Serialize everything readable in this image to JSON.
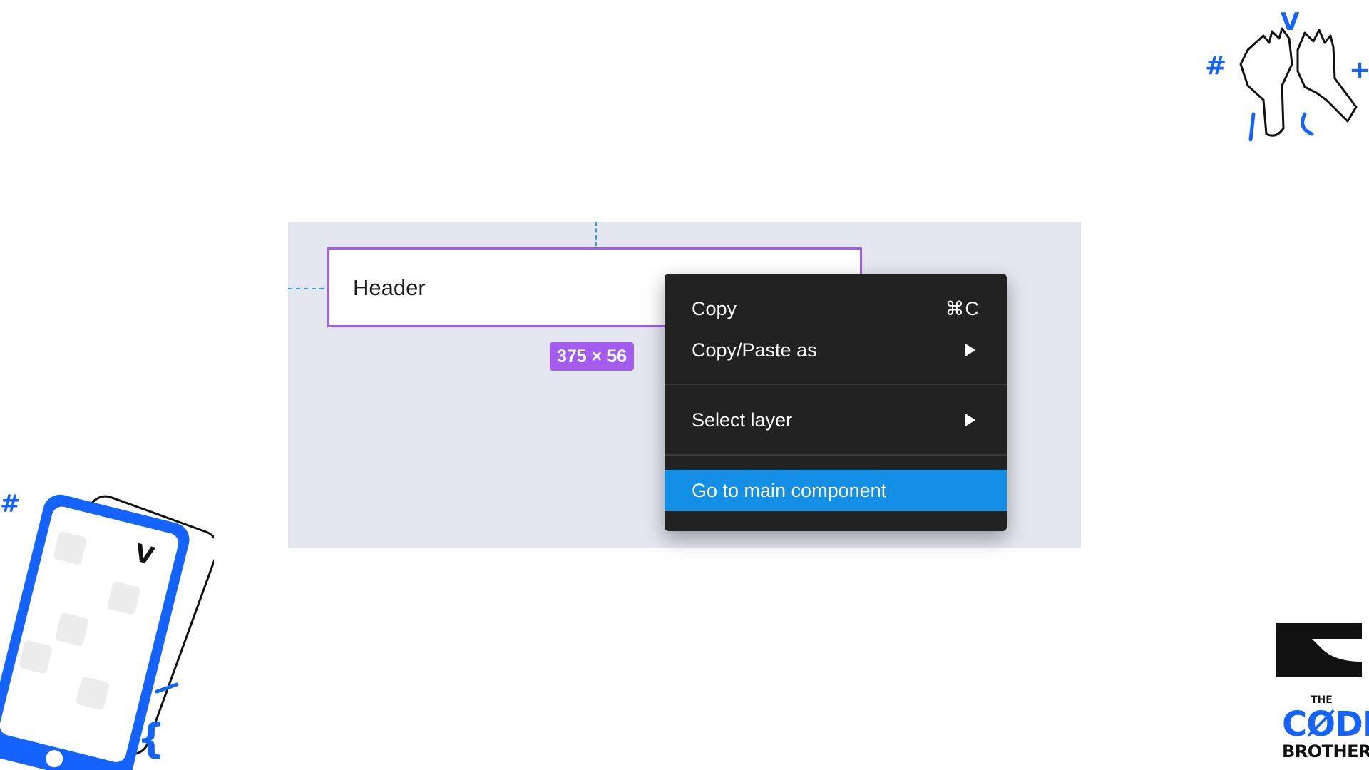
{
  "canvas": {
    "frame_label": "Header",
    "size_badge": "375 × 56"
  },
  "context_menu": {
    "items": [
      {
        "label": "Copy",
        "shortcut": "⌘C"
      },
      {
        "label": "Copy/Paste as",
        "submenu_icon": "chevron-right-icon"
      },
      {
        "label": "Select layer",
        "submenu_icon": "chevron-right-icon"
      },
      {
        "label": "Go to main component",
        "highlighted": true
      }
    ]
  },
  "branding": {
    "small_text": "THE",
    "big_text": "CØDE",
    "sub_text": "BROTHERS"
  },
  "colors": {
    "selection_purple": "#a35bf0",
    "menu_bg": "#222222",
    "menu_highlight": "#1390e6",
    "canvas_bg": "#e4e6f0",
    "brand_blue": "#1463ff"
  }
}
